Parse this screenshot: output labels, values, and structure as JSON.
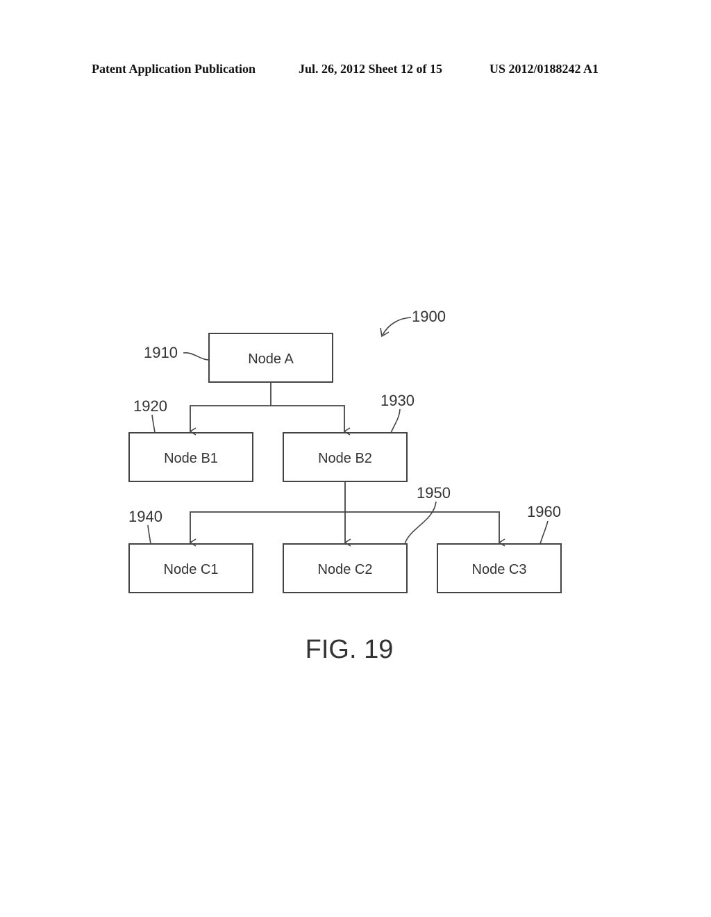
{
  "header": {
    "publication": "Patent Application Publication",
    "date_sheet": "Jul. 26, 2012   Sheet 12 of 15",
    "number": "US 2012/0188242 A1"
  },
  "diagram": {
    "figure_ref": "1900",
    "nodes": [
      {
        "id": "A",
        "label": "Node A",
        "ref": "1910"
      },
      {
        "id": "B1",
        "label": "Node B1",
        "ref": "1920"
      },
      {
        "id": "B2",
        "label": "Node B2",
        "ref": "1930"
      },
      {
        "id": "C1",
        "label": "Node C1",
        "ref": "1940"
      },
      {
        "id": "C2",
        "label": "Node C2",
        "ref": "1950"
      },
      {
        "id": "C3",
        "label": "Node C3",
        "ref": "1960"
      }
    ],
    "edges": [
      {
        "from": "A",
        "to": "B1"
      },
      {
        "from": "A",
        "to": "B2"
      },
      {
        "from": "B2",
        "to": "C1"
      },
      {
        "from": "B2",
        "to": "C2"
      },
      {
        "from": "B2",
        "to": "C3"
      }
    ],
    "caption": "FIG. 19"
  }
}
